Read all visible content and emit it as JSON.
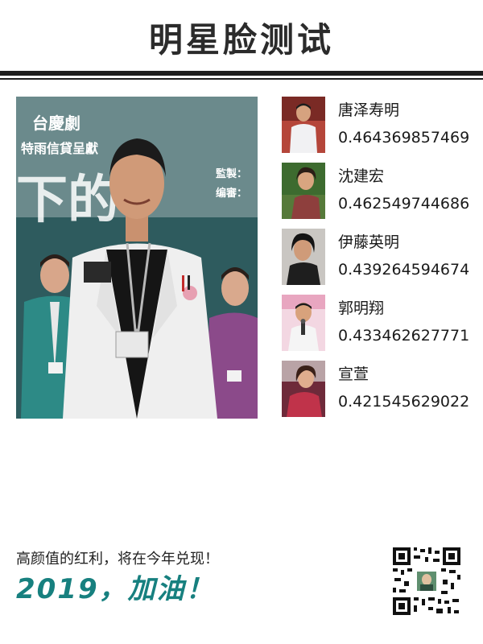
{
  "header": {
    "title": "明星脸测试"
  },
  "main_photo": {
    "poster_text_top": "台慶劇",
    "poster_text_sub": "特雨信貸呈獻",
    "poster_text_big": "下的",
    "poster_side_1": "監製：",
    "poster_side_2": "编審："
  },
  "matches": [
    {
      "name": "唐泽寿明",
      "score": "0.464369857469"
    },
    {
      "name": "沈建宏",
      "score": "0.462549744686"
    },
    {
      "name": "伊藤英明",
      "score": "0.439264594674"
    },
    {
      "name": "郭明翔",
      "score": "0.433462627771"
    },
    {
      "name": "宣萱",
      "score": "0.421545629022"
    }
  ],
  "footer": {
    "tagline": "高颜值的红利，将在今年兑现！",
    "slogan": "2019，加油！"
  },
  "colors": {
    "accent": "#17807f",
    "rule": "#1e1e1e"
  },
  "icons": {
    "qr": "qr-code-icon"
  }
}
